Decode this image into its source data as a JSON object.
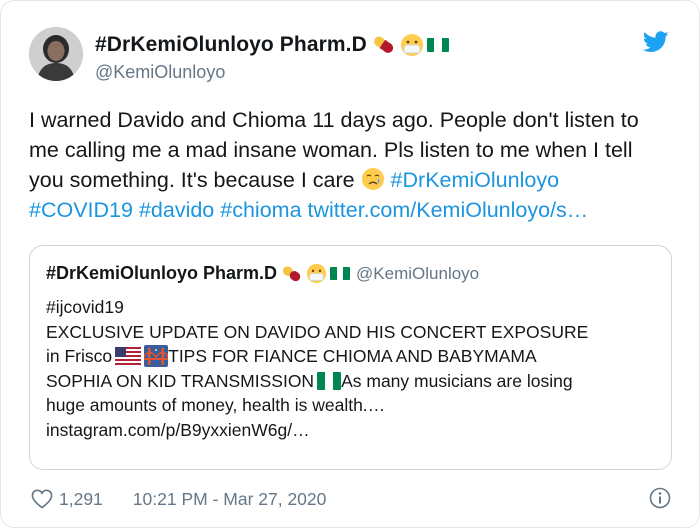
{
  "author": {
    "display_name": "#DrKemiOlunloyo Pharm.D",
    "handle": "@KemiOlunloyo",
    "avatar_icon": "profile-photo",
    "name_emojis": [
      "pill-emoji",
      "mask-face-emoji",
      "nigeria-flag-emoji"
    ]
  },
  "tweet": {
    "text_plain": "I warned Davido and Chioma 11 days ago. People don't listen to me calling me a mad insane woman. Pls listen to me when I tell you something. It's because I care ",
    "crying_emoji": "crying-face-emoji",
    "hashtag_drkemi": "#DrKemiOlunloyo",
    "hashtag_covid": "#COVID19",
    "hashtag_davido": "#davido",
    "hashtag_chioma": "#chioma",
    "link": "twitter.com/KemiOlunloyo/s…"
  },
  "quote": {
    "display_name": "#DrKemiOlunloyo Pharm.D",
    "handle": "@KemiOlunloyo",
    "line1": "#ijcovid19",
    "line2": "EXCLUSIVE UPDATE ON DAVIDO AND HIS CONCERT EXPOSURE",
    "line3_a": "in Frisco",
    "line3_b": " TIPS FOR FIANCE CHIOMA  AND BABYMAMA",
    "line4_a": "SOPHIA ON KID TRANSMISSION ",
    "line4_b": " As many musicians are losing",
    "line5": "huge amounts of money, health is wealth.…",
    "line6": "instagram.com/p/B9yxxienW6g/…"
  },
  "footer": {
    "likes": "1,291",
    "timestamp": "10:21 PM - Mar 27, 2020"
  },
  "colors": {
    "link": "#1b95e0",
    "secondary_text": "#657786",
    "twitter_blue": "#1da1f2",
    "border": "#ccd6dd"
  }
}
